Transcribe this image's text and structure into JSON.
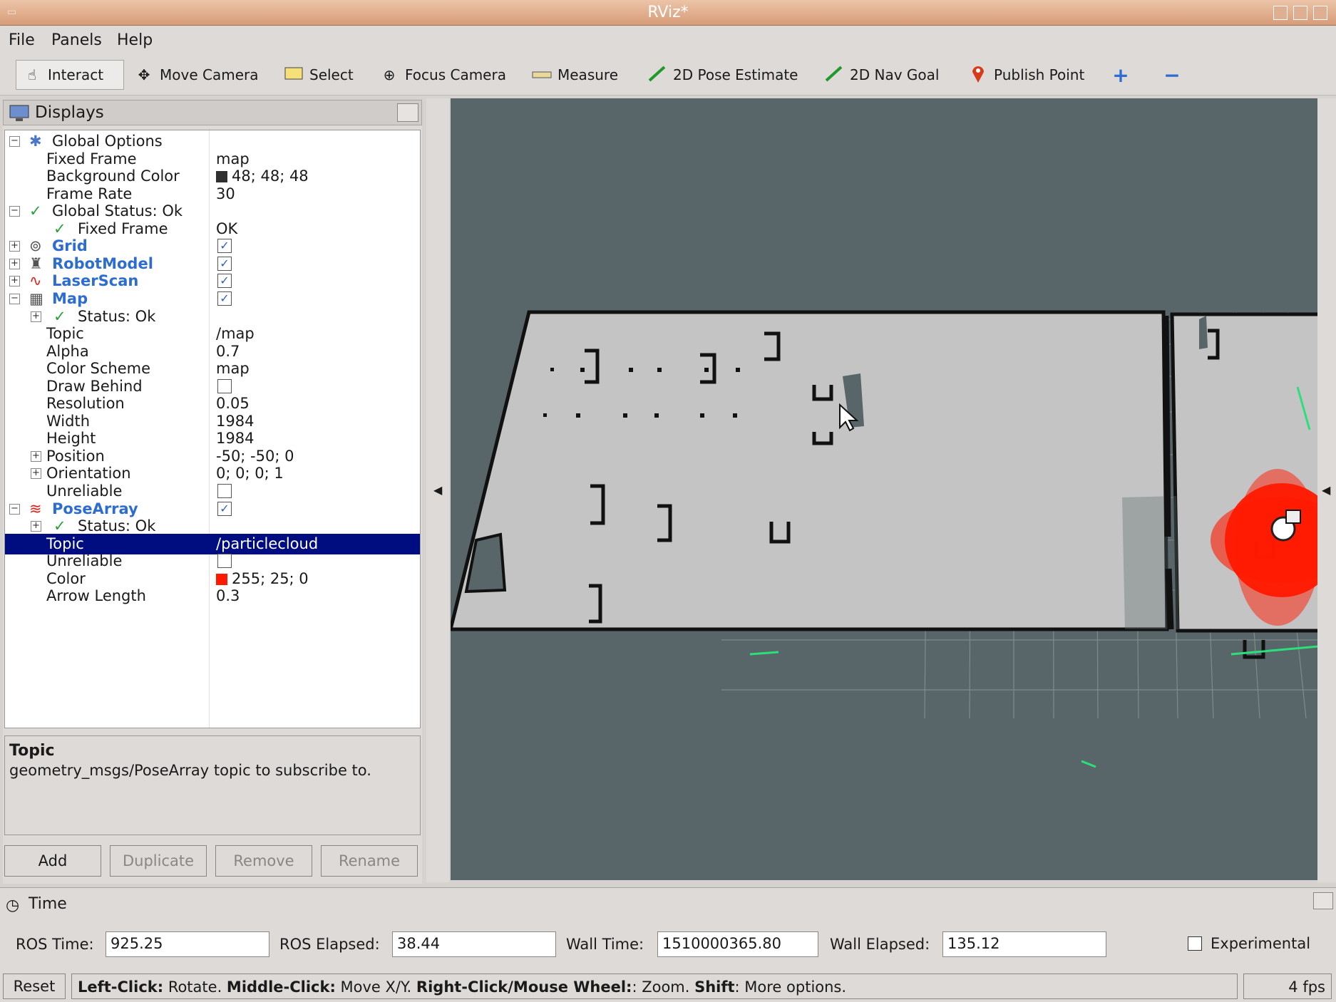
{
  "window": {
    "title": "RViz*"
  },
  "menu": [
    "File",
    "Panels",
    "Help"
  ],
  "toolbar": [
    {
      "label": "Interact",
      "icon": "hand-icon",
      "active": true
    },
    {
      "label": "Move Camera",
      "icon": "move-camera-icon"
    },
    {
      "label": "Select",
      "icon": "select-icon"
    },
    {
      "label": "Focus Camera",
      "icon": "focus-camera-icon"
    },
    {
      "label": "Measure",
      "icon": "ruler-icon"
    },
    {
      "label": "2D Pose Estimate",
      "icon": "pose-arrow-icon"
    },
    {
      "label": "2D Nav Goal",
      "icon": "goal-arrow-icon"
    },
    {
      "label": "Publish Point",
      "icon": "map-pin-icon"
    }
  ],
  "displays": {
    "title": "Displays",
    "tree": [
      {
        "label": "Global Options",
        "value": ""
      },
      {
        "label": "Fixed Frame",
        "value": "map"
      },
      {
        "label": "Background Color",
        "value": "48; 48; 48",
        "swatch": "#303030"
      },
      {
        "label": "Frame Rate",
        "value": "30"
      },
      {
        "label": "Global Status: Ok",
        "value": ""
      },
      {
        "label": "Fixed Frame",
        "value": "OK"
      },
      {
        "label": "Grid",
        "value": "",
        "checked": true
      },
      {
        "label": "RobotModel",
        "value": "",
        "checked": true
      },
      {
        "label": "LaserScan",
        "value": "",
        "checked": true
      },
      {
        "label": "Map",
        "value": "",
        "checked": true
      },
      {
        "label": "Status: Ok",
        "value": ""
      },
      {
        "label": "Topic",
        "value": "/map"
      },
      {
        "label": "Alpha",
        "value": "0.7"
      },
      {
        "label": "Color Scheme",
        "value": "map"
      },
      {
        "label": "Draw Behind",
        "value": "",
        "checked": false
      },
      {
        "label": "Resolution",
        "value": "0.05"
      },
      {
        "label": "Width",
        "value": "1984"
      },
      {
        "label": "Height",
        "value": "1984"
      },
      {
        "label": "Position",
        "value": "-50; -50; 0"
      },
      {
        "label": "Orientation",
        "value": "0; 0; 0; 1"
      },
      {
        "label": "Unreliable",
        "value": "",
        "checked": false
      },
      {
        "label": "PoseArray",
        "value": "",
        "checked": true
      },
      {
        "label": "Status: Ok",
        "value": ""
      },
      {
        "label": "Topic",
        "value": "/particlecloud",
        "selected": true
      },
      {
        "label": "Unreliable",
        "value": "",
        "checked": false
      },
      {
        "label": "Color",
        "value": "255; 25; 0",
        "swatch": "#ff1900"
      },
      {
        "label": "Arrow Length",
        "value": "0.3"
      }
    ],
    "description": {
      "heading": "Topic",
      "body": "geometry_msgs/PoseArray topic to subscribe to."
    },
    "buttons": [
      "Add",
      "Duplicate",
      "Remove",
      "Rename"
    ]
  },
  "time": {
    "title": "Time",
    "ros_time_label": "ROS Time:",
    "ros_time": "925.25",
    "ros_elapsed_label": "ROS Elapsed:",
    "ros_elapsed": "38.44",
    "wall_time_label": "Wall Time:",
    "wall_time": "1510000365.80",
    "wall_elapsed_label": "Wall Elapsed:",
    "wall_elapsed": "135.12",
    "experimental_label": "Experimental"
  },
  "status": {
    "reset_label": "Reset",
    "hint": [
      {
        "b": "Left-Click:",
        "t": " Rotate. "
      },
      {
        "b": "Middle-Click:",
        "t": " Move X/Y. "
      },
      {
        "b": "Right-Click/Mouse Wheel:",
        "t": ": Zoom. "
      },
      {
        "b": "Shift",
        "t": ": More options."
      }
    ],
    "fps": "4 fps"
  },
  "colors": {
    "background": "#58666a",
    "map_free": "#c4c4c4",
    "particles": "#ff1900",
    "selection": "#000d80",
    "accent_link": "#2d6cd0"
  }
}
